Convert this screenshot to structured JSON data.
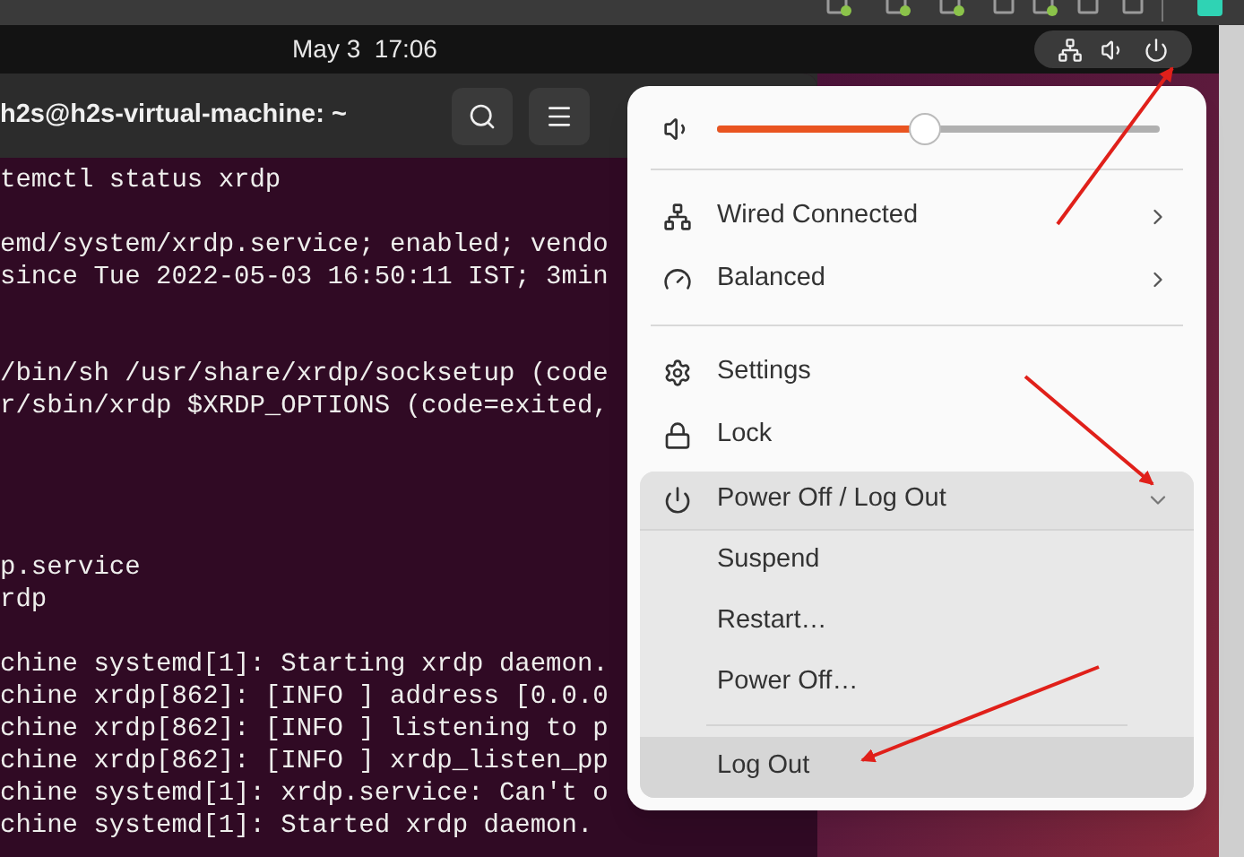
{
  "top_bar": {
    "clock": "May 3  17:06"
  },
  "terminal": {
    "title": "h2s@h2s-virtual-machine: ~",
    "lines": [
      "temctl status xrdp",
      "emd/system/xrdp.service; enabled; vendo",
      "since Tue 2022-05-03 16:50:11 IST; 3min",
      "/bin/sh /usr/share/xrdp/socksetup (code",
      "r/sbin/xrdp $XRDP_OPTIONS (code=exited,",
      "p.service",
      "rdp",
      "chine systemd[1]: Starting xrdp daemon.",
      "chine xrdp[862]: [INFO ] address [0.0.0",
      "chine xrdp[862]: [INFO ] listening to p",
      "chine xrdp[862]: [INFO ] xrdp_listen_pp",
      "chine systemd[1]: xrdp.service: Can't o",
      "chine systemd[1]: Started xrdp daemon."
    ]
  },
  "menu": {
    "volume": {
      "level": 0.47
    },
    "sections": [
      [
        {
          "kind": "submenu",
          "label": "Wired Connected"
        },
        {
          "kind": "submenu",
          "label": "Balanced"
        }
      ],
      [
        {
          "kind": "action",
          "label": "Settings"
        },
        {
          "kind": "action",
          "label": "Lock"
        }
      ]
    ],
    "power": {
      "label": "Power Off / Log Out",
      "expanded": true,
      "options": [
        {
          "label": "Suspend",
          "selected": false
        },
        {
          "label": "Restart…",
          "selected": false
        },
        {
          "label": "Power Off…",
          "selected": false
        },
        {
          "label": "Log Out",
          "selected": true
        }
      ]
    }
  }
}
